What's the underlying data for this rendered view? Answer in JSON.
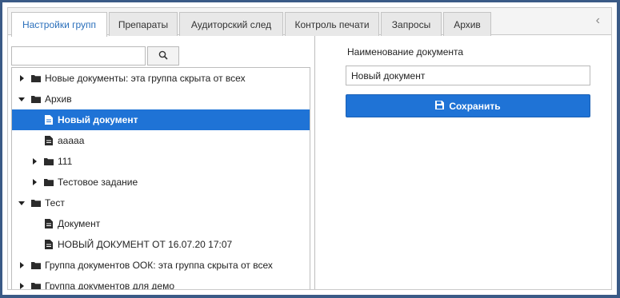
{
  "tabs": [
    {
      "label": "Настройки групп"
    },
    {
      "label": "Препараты"
    },
    {
      "label": "Аудиторский след"
    },
    {
      "label": "Контроль печати"
    },
    {
      "label": "Запросы"
    },
    {
      "label": "Архив"
    }
  ],
  "active_tab": 0,
  "search": {
    "value": "",
    "placeholder": ""
  },
  "tree": [
    {
      "label": "Новые документы: эта группа скрыта от всех",
      "type": "folder",
      "expanded": false,
      "level": 0
    },
    {
      "label": "Архив",
      "type": "folder",
      "expanded": true,
      "level": 0
    },
    {
      "label": "Новый документ",
      "type": "doc",
      "level": 1,
      "selected": true
    },
    {
      "label": "ааааа",
      "type": "doc",
      "level": 1
    },
    {
      "label": "111",
      "type": "folder",
      "expanded": false,
      "level": 1
    },
    {
      "label": "Тестовое задание",
      "type": "folder",
      "expanded": false,
      "level": 1
    },
    {
      "label": "Тест",
      "type": "folder",
      "expanded": true,
      "level": 0
    },
    {
      "label": "Документ",
      "type": "doc",
      "level": 1
    },
    {
      "label": "НОВЫЙ ДОКУМЕНТ ОТ 16.07.20 17:07",
      "type": "doc",
      "level": 1
    },
    {
      "label": "Группа документов ООК: эта группа скрыта от всех",
      "type": "folder",
      "expanded": false,
      "level": 0
    },
    {
      "label": "Группа документов для демо",
      "type": "folder",
      "expanded": false,
      "level": 0
    }
  ],
  "form": {
    "name_label": "Наименование документа",
    "name_value": "Новый документ",
    "save_label": "Сохранить"
  },
  "colors": {
    "accent": "#1f73d6",
    "frame": "#3a5a86",
    "tab_active_text": "#2a6fbb"
  }
}
